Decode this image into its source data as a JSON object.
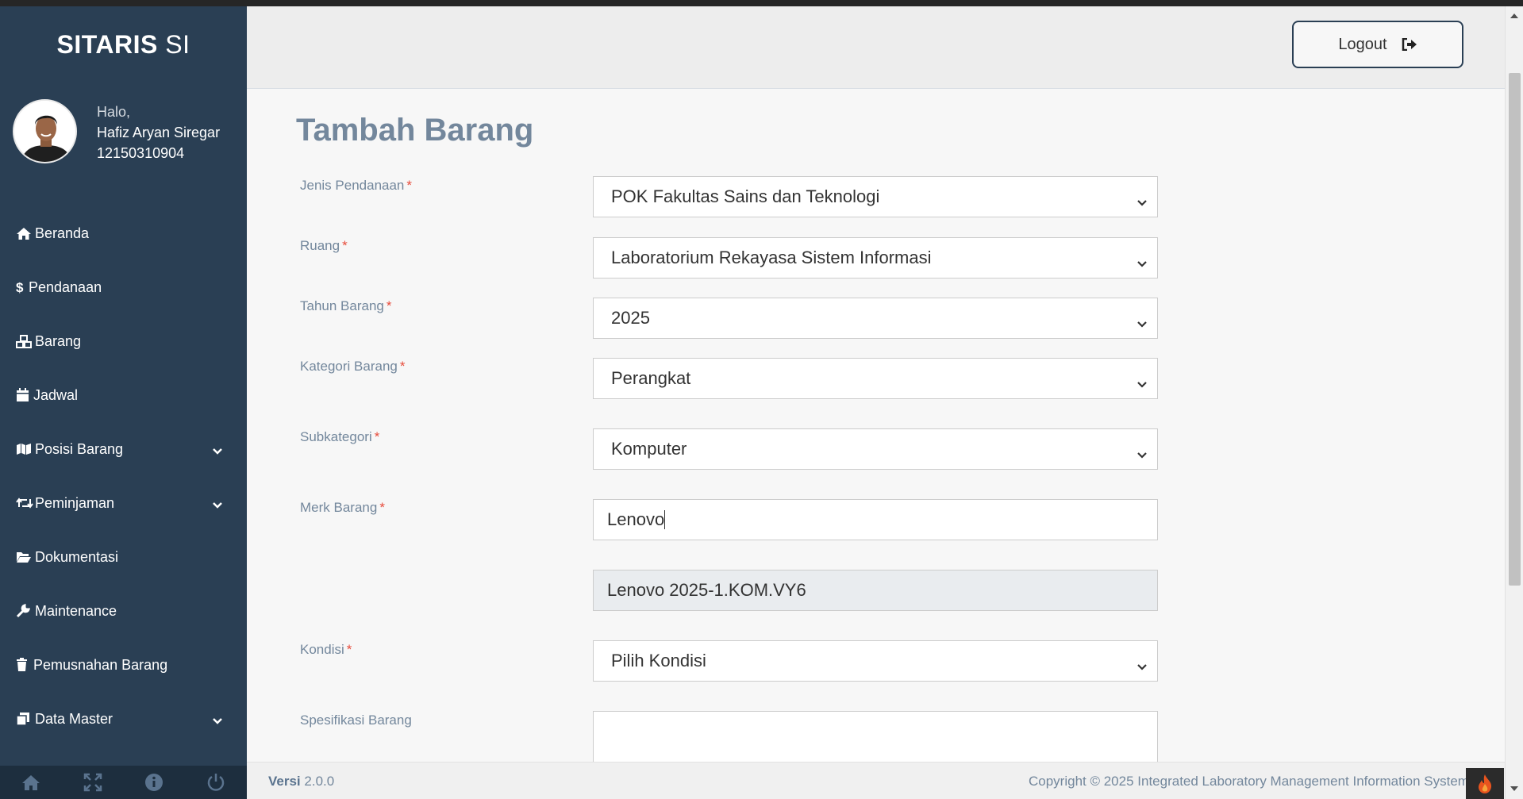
{
  "sidebar": {
    "brand_bold": "SITARIS",
    "brand_rest": " SI",
    "greeting": "Halo,",
    "user_name": "Hafiz Aryan Siregar",
    "user_id": "12150310904",
    "items": [
      {
        "label": "Beranda",
        "icon": "home-icon"
      },
      {
        "label": "Pendanaan",
        "icon": "dollar-icon"
      },
      {
        "label": "Barang",
        "icon": "cubes-icon"
      },
      {
        "label": "Jadwal",
        "icon": "calendar-icon"
      },
      {
        "label": "Posisi Barang",
        "icon": "map-icon"
      },
      {
        "label": "Peminjaman",
        "icon": "retweet-icon"
      },
      {
        "label": "Dokumentasi",
        "icon": "folder-open-icon"
      },
      {
        "label": "Maintenance",
        "icon": "wrench-icon"
      },
      {
        "label": "Pemusnahan Barang",
        "icon": "trash-icon"
      },
      {
        "label": "Data Master",
        "icon": "clone-icon"
      }
    ],
    "footer_icons": [
      "home-icon",
      "fullscreen-icon",
      "info-icon",
      "power-icon"
    ]
  },
  "topbar": {
    "logout_label": "Logout"
  },
  "form": {
    "title": "Tambah Barang",
    "required_mark": "*",
    "fields": {
      "jenis_pendanaan": {
        "label": "Jenis Pendanaan",
        "value": "POK Fakultas Sains dan Teknologi"
      },
      "ruang": {
        "label": "Ruang",
        "value": "Laboratorium Rekayasa Sistem Informasi"
      },
      "tahun_barang": {
        "label": "Tahun Barang",
        "value": "2025"
      },
      "kategori_barang": {
        "label": "Kategori Barang",
        "value": "Perangkat"
      },
      "subkategori": {
        "label": "Subkategori",
        "value": "Komputer"
      },
      "merk_barang": {
        "label": "Merk Barang",
        "value": "Lenovo"
      },
      "kode_barang": {
        "value": "Lenovo 2025-1.KOM.VY6"
      },
      "kondisi": {
        "label": "Kondisi",
        "value": "Pilih Kondisi"
      },
      "spesifikasi_barang": {
        "label": "Spesifikasi Barang",
        "value": ""
      }
    }
  },
  "footer": {
    "version_label": "Versi",
    "version_number": "2.0.0",
    "copyright": "Copyright © 2025 Integrated Laboratory Management Information System"
  },
  "colors": {
    "sidebar_bg": "#2a3f54",
    "title_color": "#73879c",
    "required_color": "#e74c3c"
  }
}
